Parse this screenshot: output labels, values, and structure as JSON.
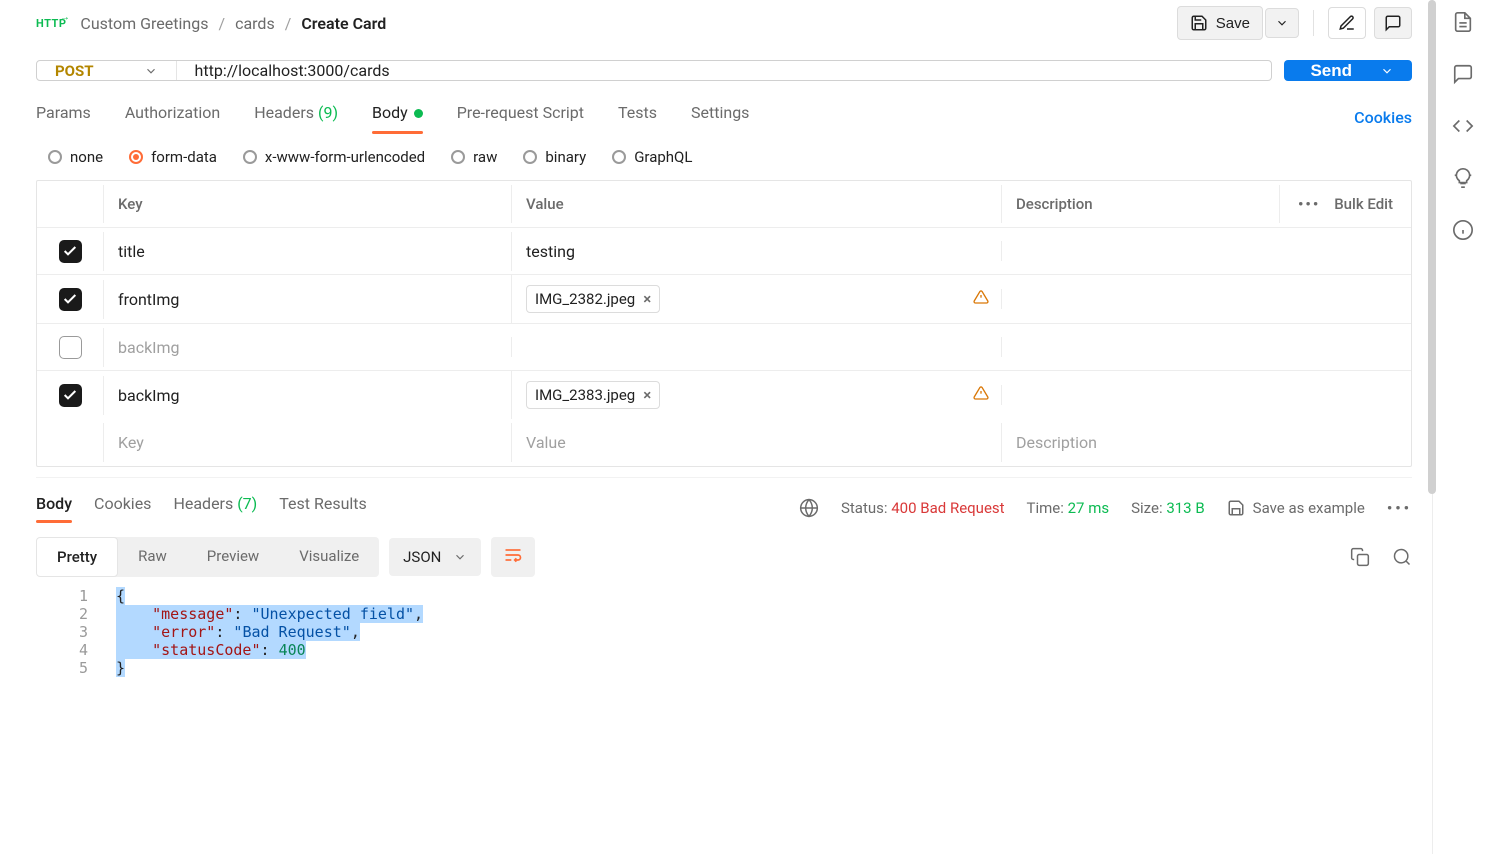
{
  "breadcrumbs": {
    "collection": "Custom Greetings",
    "folder": "cards",
    "request": "Create Card"
  },
  "toolbar": {
    "save_label": "Save"
  },
  "request": {
    "method": "POST",
    "url": "http://localhost:3000/cards",
    "send_label": "Send"
  },
  "req_tabs": {
    "params": "Params",
    "auth": "Authorization",
    "headers": "Headers",
    "headers_count": "(9)",
    "body": "Body",
    "prerequest": "Pre-request Script",
    "tests": "Tests",
    "settings": "Settings",
    "cookies_link": "Cookies"
  },
  "body_types": {
    "none": "none",
    "form_data": "form-data",
    "xwww": "x-www-form-urlencoded",
    "raw": "raw",
    "binary": "binary",
    "graphql": "GraphQL",
    "selected": "form-data"
  },
  "fd_headers": {
    "key": "Key",
    "value": "Value",
    "description": "Description",
    "bulk_edit": "Bulk Edit"
  },
  "fd_rows": [
    {
      "enabled": true,
      "key": "title",
      "value": "testing",
      "file": false,
      "warn": false
    },
    {
      "enabled": true,
      "key": "frontImg",
      "value": "IMG_2382.jpeg",
      "file": true,
      "warn": true
    },
    {
      "enabled": false,
      "key": "backImg",
      "value": "",
      "file": false,
      "warn": false
    },
    {
      "enabled": true,
      "key": "backImg",
      "value": "IMG_2383.jpeg",
      "file": true,
      "warn": true
    }
  ],
  "fd_placeholder": {
    "key": "Key",
    "value": "Value",
    "description": "Description"
  },
  "resp_tabs": {
    "body": "Body",
    "cookies": "Cookies",
    "headers": "Headers",
    "headers_count": "(7)",
    "test_results": "Test Results"
  },
  "resp_meta": {
    "status_label": "Status:",
    "status_value": "400 Bad Request",
    "time_label": "Time:",
    "time_value": "27 ms",
    "size_label": "Size:",
    "size_value": "313 B",
    "save_example": "Save as example"
  },
  "view_modes": {
    "pretty": "Pretty",
    "raw": "Raw",
    "preview": "Preview",
    "visualize": "Visualize",
    "lang": "JSON"
  },
  "response_body": {
    "message": "Unexpected field",
    "error": "Bad Request",
    "statusCode": 400
  }
}
